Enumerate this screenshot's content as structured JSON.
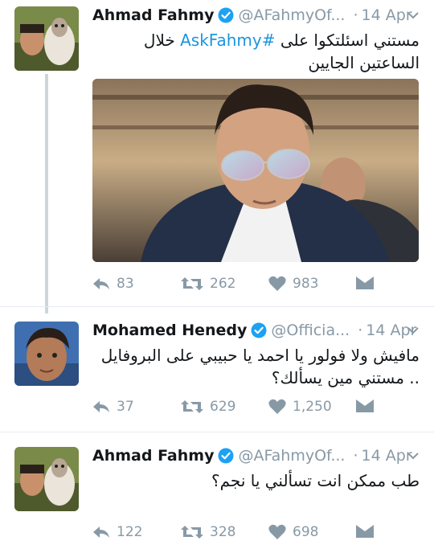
{
  "tweets": [
    {
      "name": "Ahmad Fahmy",
      "handle": "@AFahmyOf...",
      "separator": "·",
      "date": "14 Apr",
      "text_pre": "مستني اسئلتكوا على ",
      "hashtag": "#AskFahmy",
      "text_post": " خلال الساعتين الجايين",
      "replies": "83",
      "retweets": "262",
      "likes": "983"
    },
    {
      "name": "Mohamed Henedy",
      "handle": "@Officia...",
      "separator": "·",
      "date": "14 Apr",
      "text": "مافيش ولا فولور يا احمد يا حبيبي على البروفايل .. مستني مين يسألك؟",
      "replies": "37",
      "retweets": "629",
      "likes": "1,250"
    },
    {
      "name": "Ahmad Fahmy",
      "handle": "@AFahmyOf...",
      "separator": "·",
      "date": "14 Apr",
      "text": "طب ممكن انت تسألني يا نجم؟",
      "replies": "122",
      "retweets": "328",
      "likes": "698"
    }
  ],
  "icons": {
    "reply": "reply-icon",
    "retweet": "retweet-icon",
    "like": "heart-icon",
    "dm": "envelope-icon",
    "verified": "verified-badge-icon",
    "more": "chevron-down-icon"
  },
  "colors": {
    "link": "#1b95e0",
    "meta": "#8899a6",
    "verified": "#1da1f2",
    "line": "#ccd6dd"
  }
}
